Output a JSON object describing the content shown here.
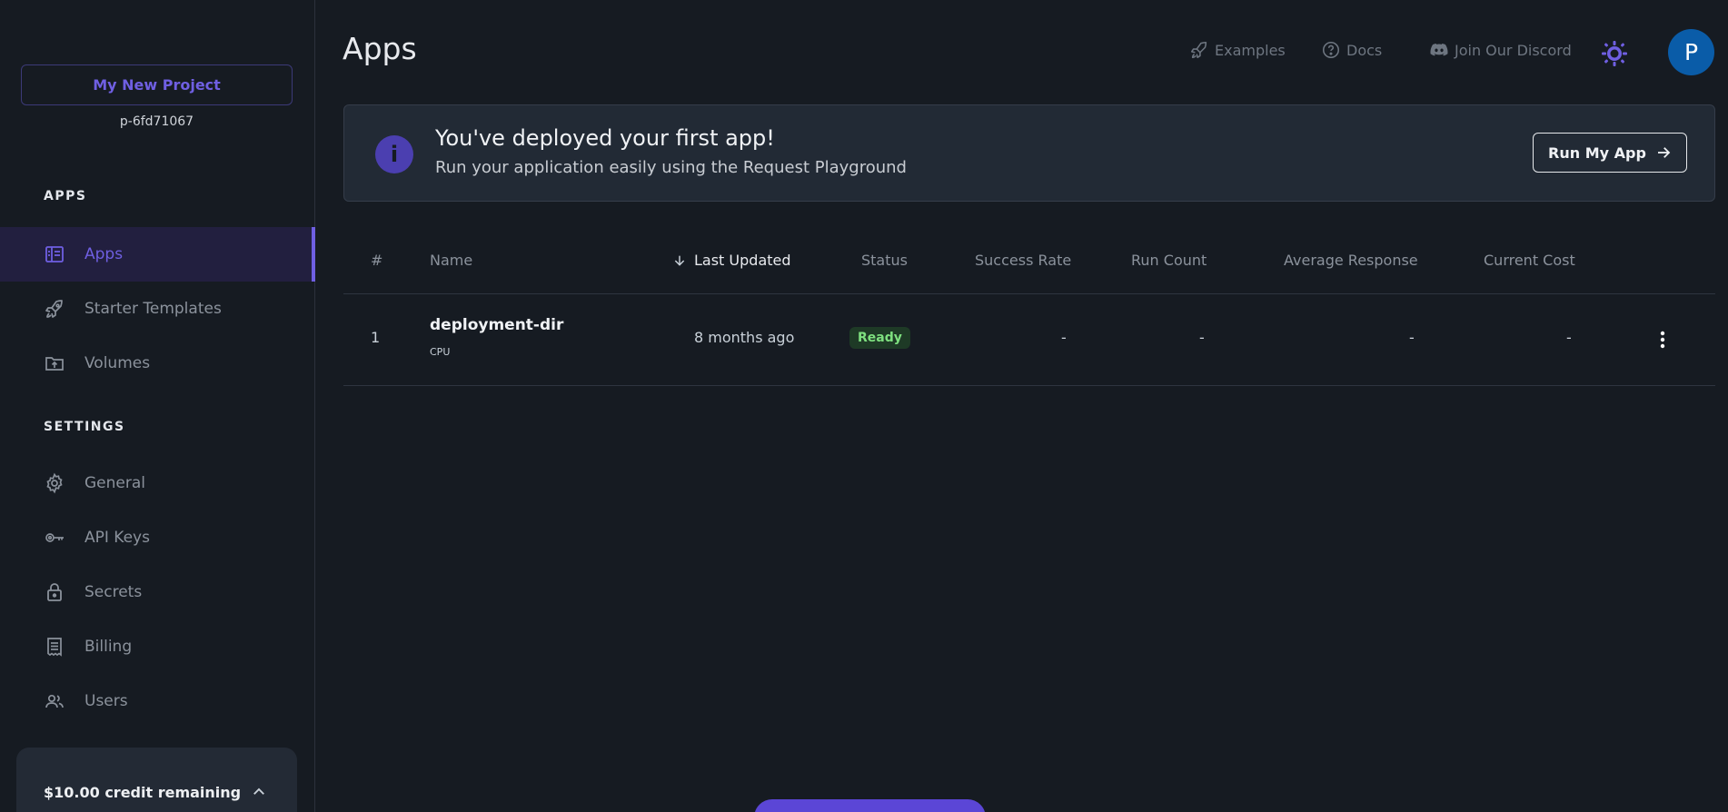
{
  "sidebar": {
    "project_name": "My New Project",
    "project_id": "p-6fd71067",
    "sections": {
      "apps": "APPS",
      "settings": "SETTINGS"
    },
    "items": [
      {
        "label": "Apps",
        "icon": "apps-icon"
      },
      {
        "label": "Starter Templates",
        "icon": "rocket-icon"
      },
      {
        "label": "Volumes",
        "icon": "folder-upload-icon"
      },
      {
        "label": "General",
        "icon": "gear-icon"
      },
      {
        "label": "API Keys",
        "icon": "key-icon"
      },
      {
        "label": "Secrets",
        "icon": "lock-icon"
      },
      {
        "label": "Billing",
        "icon": "receipt-icon"
      },
      {
        "label": "Users",
        "icon": "users-icon"
      }
    ],
    "credit": "$10.00 credit remaining"
  },
  "header": {
    "title": "Apps",
    "links": {
      "examples": "Examples",
      "docs": "Docs",
      "discord": "Join Our Discord"
    },
    "avatar_initial": "P"
  },
  "banner": {
    "title": "You've deployed your first app!",
    "subtitle": "Run your application easily using the Request Playground",
    "button": "Run My App"
  },
  "table": {
    "headers": [
      "#",
      "Name",
      "Last Updated",
      "Status",
      "Success Rate",
      "Run Count",
      "Average Response",
      "Current Cost"
    ],
    "rows": [
      {
        "index": "1",
        "name": "deployment-dir",
        "type": "CPU",
        "updated": "8 months ago",
        "status": "Ready",
        "success_rate": "-",
        "run_count": "-",
        "avg_response": "-",
        "cost": "-"
      }
    ]
  },
  "colors": {
    "accent": "#6f5fe2",
    "background": "#161b22",
    "status_ready": "#7ee07f"
  }
}
